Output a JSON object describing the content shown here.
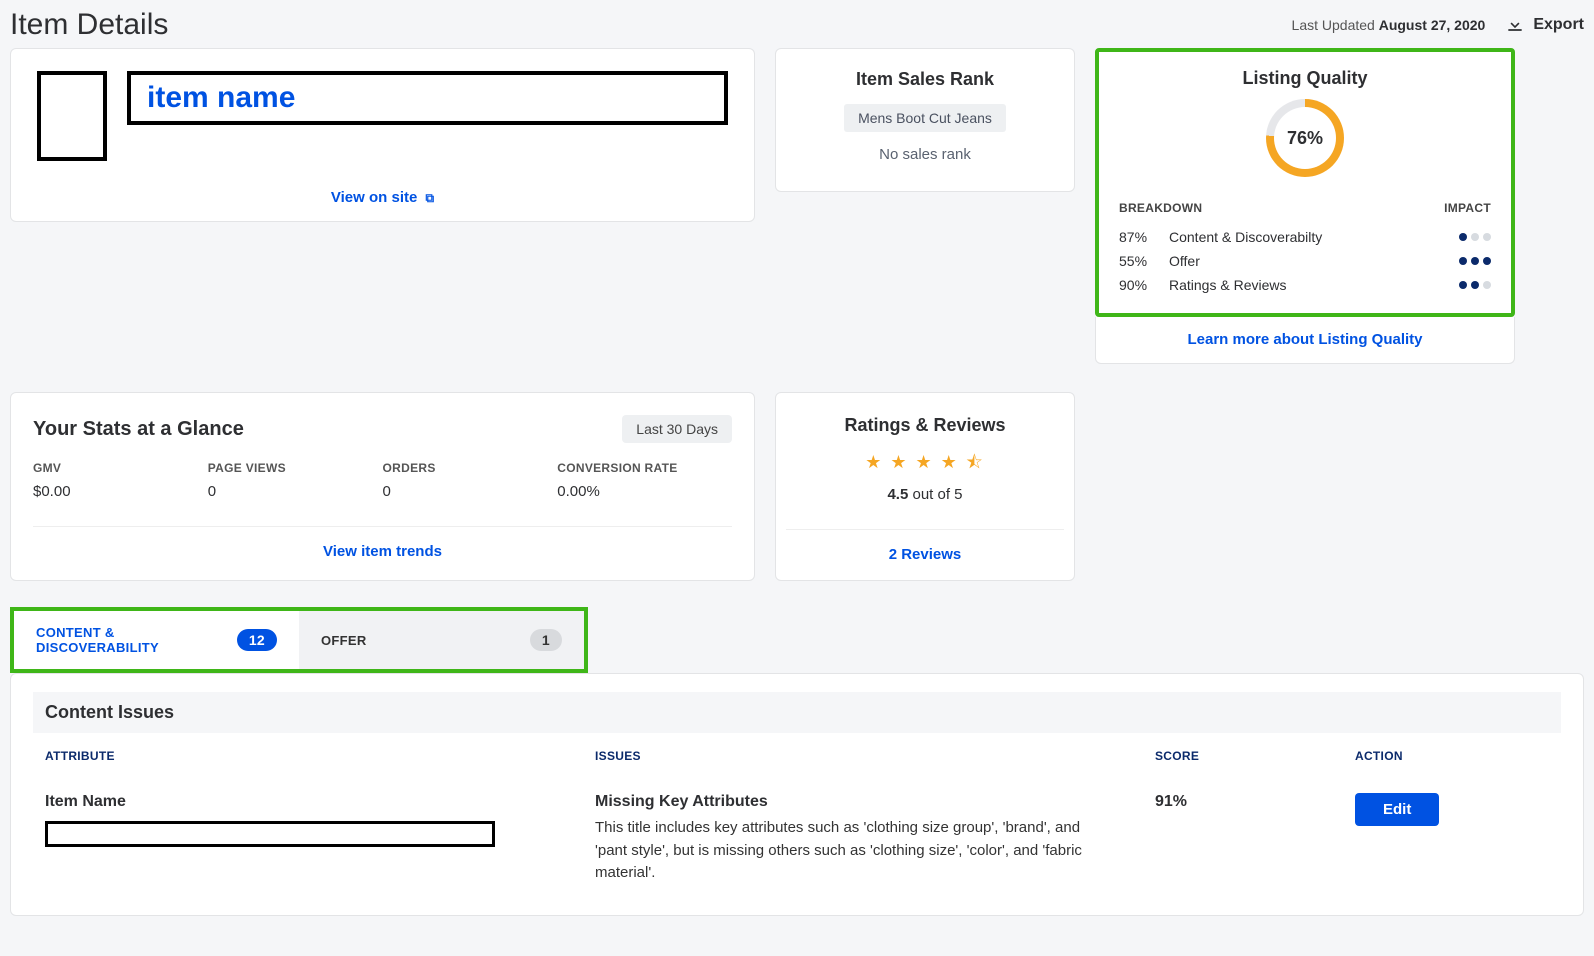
{
  "header": {
    "title": "Item Details",
    "last_updated_label": "Last Updated",
    "last_updated_date": "August 27, 2020",
    "export": "Export"
  },
  "item": {
    "name": "item name",
    "view_on_site": "View on site"
  },
  "sales_rank": {
    "title": "Item Sales Rank",
    "category": "Mens Boot Cut Jeans",
    "rank_text": "No sales rank"
  },
  "quality": {
    "title": "Listing Quality",
    "percent": "76%",
    "breakdown_label": "BREAKDOWN",
    "impact_label": "IMPACT",
    "rows": [
      {
        "pct": "87%",
        "label": "Content & Discoverabilty",
        "impact": 1
      },
      {
        "pct": "55%",
        "label": "Offer",
        "impact": 3
      },
      {
        "pct": "90%",
        "label": "Ratings & Reviews",
        "impact": 2
      }
    ],
    "learn_more": "Learn more about Listing Quality"
  },
  "stats": {
    "title": "Your Stats at a Glance",
    "period": "Last 30 Days",
    "items": [
      {
        "label": "GMV",
        "value": "$0.00"
      },
      {
        "label": "PAGE VIEWS",
        "value": "0"
      },
      {
        "label": "ORDERS",
        "value": "0"
      },
      {
        "label": "CONVERSION RATE",
        "value": "0.00%"
      }
    ],
    "trends_link": "View item trends"
  },
  "ratings": {
    "title": "Ratings & Reviews",
    "score": "4.5",
    "out_of": " out of 5",
    "reviews_link": "2 Reviews"
  },
  "tabs": {
    "content": {
      "label": "CONTENT & DISCOVERABILITY",
      "count": "12"
    },
    "offer": {
      "label": "OFFER",
      "count": "1"
    }
  },
  "issues": {
    "title": "Content Issues",
    "columns": {
      "attribute": "ATTRIBUTE",
      "issues": "ISSUES",
      "score": "SCORE",
      "action": "ACTION"
    },
    "rows": [
      {
        "attribute": "Item Name",
        "issue_title": "Missing Key Attributes",
        "issue_desc": "This title includes key attributes such as 'clothing size group', 'brand', and 'pant style', but is missing others such as 'clothing size', 'color', and 'fabric material'.",
        "score": "91%",
        "action": "Edit"
      }
    ]
  }
}
